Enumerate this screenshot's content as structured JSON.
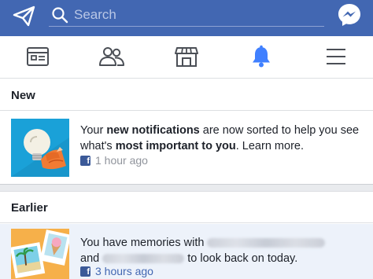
{
  "header": {
    "search_placeholder": "Search",
    "left_icon": "paper-plane-icon",
    "right_icon": "messenger-icon",
    "bar_color": "#4267b2"
  },
  "tabs": [
    {
      "name": "news-feed",
      "icon": "newsfeed-icon",
      "active": false
    },
    {
      "name": "friends",
      "icon": "friends-icon",
      "active": false
    },
    {
      "name": "marketplace",
      "icon": "marketplace-icon",
      "active": false
    },
    {
      "name": "notifications",
      "icon": "bell-icon",
      "active": true
    },
    {
      "name": "menu",
      "icon": "hamburger-menu-icon",
      "active": false
    }
  ],
  "sections": {
    "new_label": "New",
    "earlier_label": "Earlier"
  },
  "notifications": [
    {
      "text_pre": "Your ",
      "text_bold1": "new notifications",
      "text_mid": " are now sorted to help you see what's ",
      "text_bold2": "most important to you",
      "text_post": ". Learn more.",
      "time": "1 hour ago",
      "unread": false,
      "thumb_icon": "lightbulb-icon"
    },
    {
      "text_pre": "You have memories with",
      "text_and": "and",
      "text_post": "to look back on today.",
      "time": "3 hours ago",
      "unread": true,
      "thumb_icon": "memories-photos-icon"
    }
  ],
  "colors": {
    "accent": "#4267b2",
    "unread_bg": "#edf2fa",
    "meta_gray": "#90949c",
    "section_gap": "#e9ebee"
  }
}
